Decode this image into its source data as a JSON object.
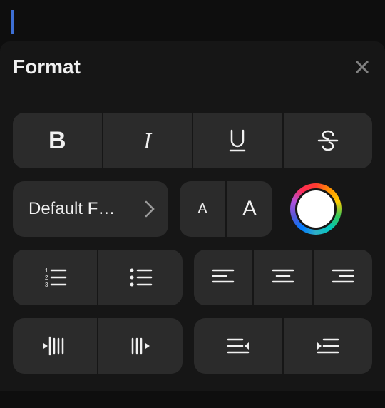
{
  "panel": {
    "title": "Format"
  },
  "style": {
    "bold": "B",
    "italic": "I"
  },
  "font": {
    "label": "Default F…"
  },
  "size": {
    "smaller": "A",
    "larger": "A"
  }
}
